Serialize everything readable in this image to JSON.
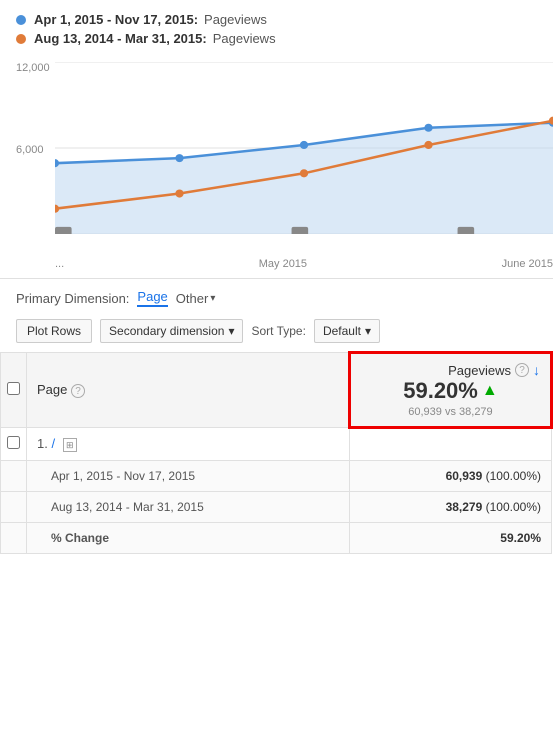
{
  "legend": {
    "row1": {
      "dates": "Apr 1, 2015 - Nov 17, 2015:",
      "dot": "blue",
      "type": "Pageviews"
    },
    "row2": {
      "dates": "Aug 13, 2014 - Mar 31, 2015:",
      "dot": "orange",
      "type": "Pageviews"
    }
  },
  "chart": {
    "y_top": "12,000",
    "y_mid": "6,000",
    "x_labels": [
      "...",
      "May 2015",
      "June 2015"
    ]
  },
  "primary_dimension": {
    "label": "Primary Dimension:",
    "page_btn": "Page",
    "other_btn": "Other"
  },
  "toolbar": {
    "plot_rows_label": "Plot Rows",
    "secondary_label": "Secondary dimension",
    "sort_type_label": "Sort Type:",
    "default_label": "Default"
  },
  "table": {
    "col_page": "Page",
    "col_pageviews": "Pageviews",
    "highlight": {
      "percent": "59.20%",
      "comparison": "60,939 vs 38,279"
    },
    "row1": {
      "num": "1.",
      "page": "/"
    },
    "subrow1": {
      "label": "Apr 1, 2015 - Nov 17, 2015",
      "value": "60,939",
      "pct": "(100.00%)"
    },
    "subrow2": {
      "label": "Aug 13, 2014 - Mar 31, 2015",
      "value": "38,279",
      "pct": "(100.00%)"
    },
    "subrow3": {
      "label": "% Change",
      "value": "59.20%"
    }
  }
}
